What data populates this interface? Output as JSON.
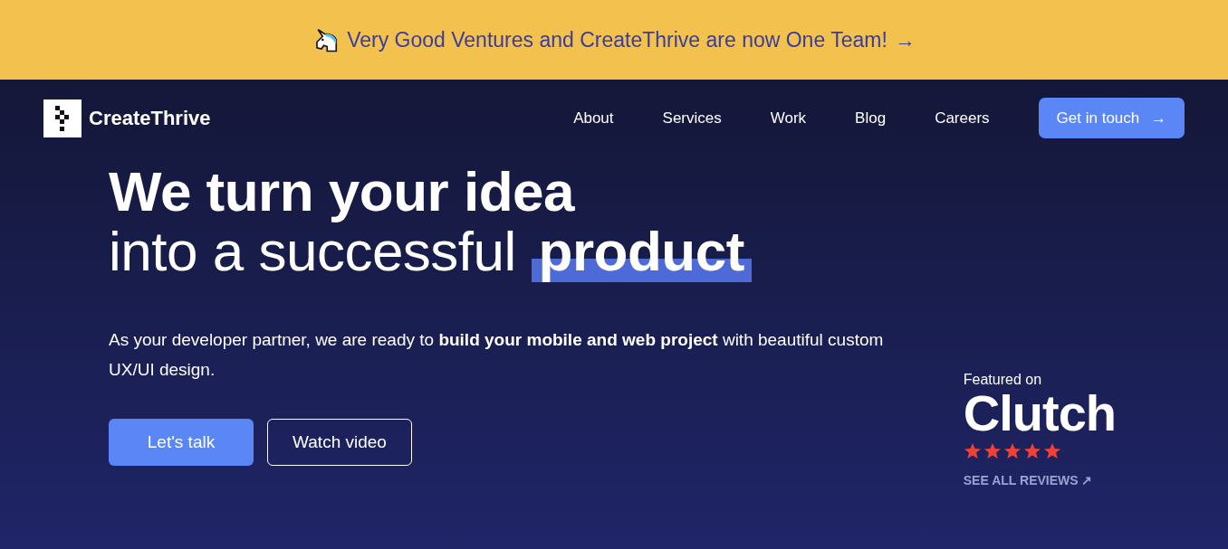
{
  "banner": {
    "text": "Very Good Ventures and CreateThrive are now One Team!",
    "arrow": "→"
  },
  "nav": {
    "logo": "CreateThrive",
    "links": [
      "About",
      "Services",
      "Work",
      "Blog",
      "Careers"
    ],
    "cta": {
      "label": "Get in touch",
      "arrow": "→"
    }
  },
  "hero": {
    "headline": [
      {
        "text": "We turn your idea",
        "kind": "bold"
      },
      {
        "text": "into a successful",
        "kind": "light",
        "highlight": "product"
      }
    ],
    "description": "As your developer partner, we are ready to **build your mobile and web project** with beautiful custom UX/UI design.",
    "buttons": [
      {
        "label": "Let's talk",
        "kind": "primary"
      },
      {
        "label": "Watch video",
        "kind": "outline"
      }
    ]
  },
  "clutch": {
    "caption": "Featured on",
    "brand": "Clutch",
    "stars": 5,
    "link": "SEE ALL REVIEWS",
    "link_arrow": "↗"
  }
}
